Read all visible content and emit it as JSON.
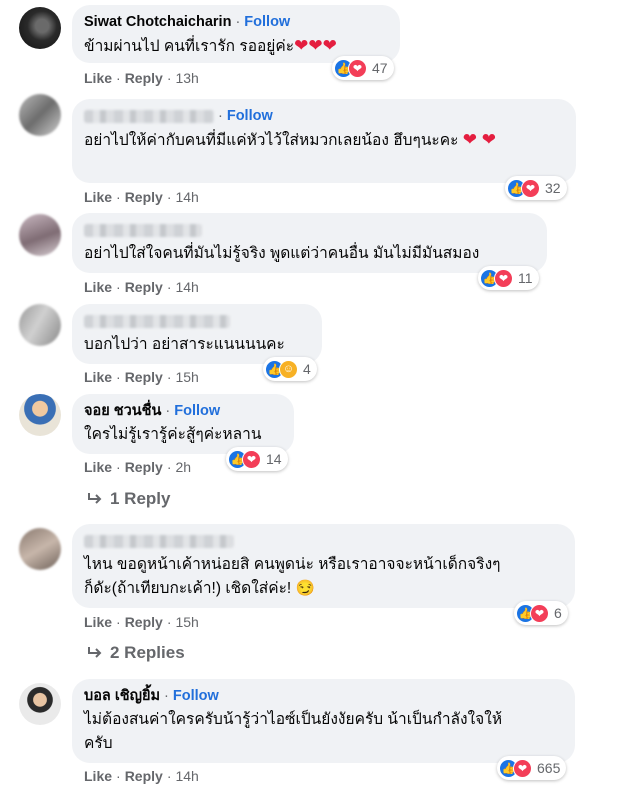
{
  "ui": {
    "follow": "Follow",
    "like": "Like",
    "reply": "Reply",
    "dot": "·"
  },
  "colors": {
    "link": "#216fdb",
    "like": "#1b74e4",
    "love": "#f33e58",
    "care": "#f7b125"
  },
  "comments": [
    {
      "name": "Siwat Chotchaicharin",
      "name_blurred": false,
      "avatar": "dark-photo",
      "text": "ข้ามผ่านไป คนที่เรารัก รออยู่ค่ะ",
      "text_emoji": "❤❤❤",
      "time": "13h",
      "reactions": [
        "like-icon",
        "love-icon"
      ],
      "count": "47"
    },
    {
      "name": "",
      "name_blurred": true,
      "avatar": "blurred",
      "text": "อย่าไปให้ค่ากับคนที่มีแค่หัวไว้ใส่หมวกเลยน้อง ฮึบๆนะคะ",
      "text_emoji": "❤ ❤",
      "time": "14h",
      "reactions": [
        "like-icon",
        "love-icon"
      ],
      "count": "32"
    },
    {
      "name": "",
      "name_blurred": true,
      "avatar": "blurred",
      "text": "อย่าไปใส่ใจคนที่มันไม่รู้จริง พูดแต่ว่าคนอื่น มันไม่มีมันสมอง",
      "text_emoji": "",
      "time": "14h",
      "reactions": [
        "like-icon",
        "love-icon"
      ],
      "count": "11"
    },
    {
      "name": "",
      "name_blurred": true,
      "avatar": "blurred",
      "text": "บอกไปว่า อย่าสาระแนนนนคะ",
      "text_emoji": "",
      "time": "15h",
      "reactions": [
        "like-icon",
        "care-icon"
      ],
      "count": "4"
    },
    {
      "name": "จอย ชวนชื่น",
      "name_blurred": false,
      "avatar": "woman-photo",
      "text": "ใครไม่รู้เรารู้ค่ะสู้ๆค่ะหลาน",
      "text_emoji": "",
      "time": "2h",
      "reactions": [
        "like-icon",
        "love-icon"
      ],
      "count": "14",
      "replies": "1 Reply"
    },
    {
      "name": "",
      "name_blurred": true,
      "avatar": "blurred",
      "text": "ไหน ขอดูหน้าเค้าหน่อยสิ คนพูดน่ะ หรือเราอาจจะหน้าเด็กจริงๆ\nก็ดัะ(ถ้าเทียบกะเค้า!) เชิดใส่ค่ะ!",
      "text_emoji": "😏",
      "time": "15h",
      "reactions": [
        "like-icon",
        "love-icon"
      ],
      "count": "6",
      "replies": "2 Replies"
    },
    {
      "name": "บอล เชิญยิ้ม",
      "name_blurred": false,
      "avatar": "man-photo",
      "text": "ไม่ต้องสนค่าใครครับน้ารู้ว่าไอซ์เป็นยังงัยครับ น้าเป็นกำลังใจให้\nครับ",
      "text_emoji": "",
      "time": "14h",
      "reactions": [
        "like-icon",
        "love-icon"
      ],
      "count": "665"
    }
  ]
}
